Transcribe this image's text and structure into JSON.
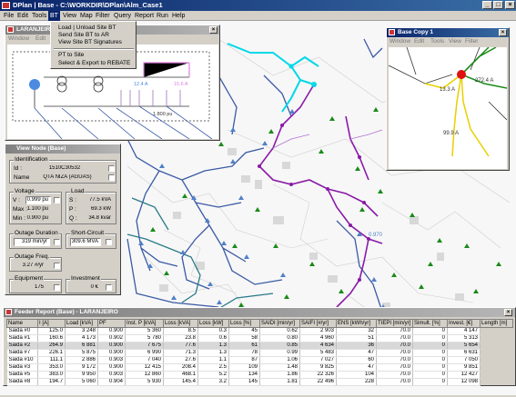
{
  "app": {
    "title": "DPlan  |  Base - C:\\WORKDIR\\DPlan\\Alm_Case1",
    "btn_min": "_",
    "btn_max": "□",
    "btn_close": "×"
  },
  "menu": [
    "File",
    "Edit",
    "Tools",
    "BT",
    "View",
    "Map",
    "Filter",
    "Query",
    "Report",
    "Run",
    "Help"
  ],
  "bt_menu": {
    "items": [
      "Load | Unload Site BT",
      "Send Site BT to AR",
      "View Site BT Signatures",
      "PT to Site",
      "Select & Export to REBATE"
    ]
  },
  "schematic": {
    "title": "LARANJEIRO",
    "menu": [
      "Window",
      "Edit"
    ],
    "labels": {
      "a": "12.4 A",
      "b": "15.6 A",
      "c": "1.800 pu"
    }
  },
  "base_copy": {
    "title": "Base Copy 1",
    "menu": [
      "Window",
      "Edit",
      "Tools",
      "View",
      "Filter"
    ],
    "labels": {
      "a": "13.3 A",
      "b": "272.4 A",
      "c": "99.9 A"
    }
  },
  "map_labels": {
    "a": "0.970"
  },
  "view_node": {
    "title": "View Node (Base)",
    "identification": {
      "legend": "Identification",
      "id_label": "Id :",
      "id_value": "1510C30532",
      "name_label": "Name",
      "name_value": "QTA NIZA (AGUAS)"
    },
    "voltage": {
      "legend": "Voltage",
      "v_label": "V :",
      "v_value": "0.999 pu",
      "max_label": "Max :",
      "max_value": "1.100 pu",
      "min_label": "Min :",
      "min_value": "0.900 pu"
    },
    "load": {
      "legend": "Load",
      "s_label": "S :",
      "s_value": "77.5 kVA",
      "p_label": "P :",
      "p_value": "69.3 kW",
      "q_label": "Q :",
      "q_value": "34.8 kvar"
    },
    "outage_duration": {
      "legend": "Outage Duration",
      "value": "319 min/yr"
    },
    "short_circuit": {
      "legend": "Short-Circuit",
      "value": "309.6 MVA"
    },
    "outage_freq": {
      "legend": "Outage Freq.",
      "value": "3.27 #/yr"
    },
    "equipment": {
      "legend": "Equipment",
      "value": "175"
    },
    "investment": {
      "legend": "Investment",
      "value": "0 €"
    }
  },
  "feeder_report": {
    "title": "Feeder Report (Base) - LARANJEIRO",
    "columns": [
      "Name",
      "I [A]",
      "Load [kVA]",
      "PF",
      "Inst. P [kVA]",
      "Loss [kVA]",
      "Loss [kW]",
      "Loss [%]",
      "SAIDI [min/yr]",
      "SAIFI [#/yr]",
      "ENS [kWh/yr]",
      "TIEPI [min/yr]",
      "Simult. [%]",
      "Invest. [€]",
      "Length [m]"
    ],
    "rows": [
      [
        "Saida #0",
        "125.0",
        "3 248",
        "0.900",
        "5 360",
        "8.5",
        "0.3",
        "45",
        "0.62",
        "2 903",
        "32",
        "70.0",
        "0",
        "4 147"
      ],
      [
        "Saida #1",
        "160.6",
        "4 173",
        "0.902",
        "5 780",
        "23.8",
        "0.6",
        "58",
        "0.80",
        "4 960",
        "51",
        "70.0",
        "0",
        "5 313"
      ],
      [
        "Saida #2",
        "264.9",
        "6 881",
        "0.900",
        "7 675",
        "77.6",
        "1.3",
        "61",
        "0.85",
        "4 634",
        "36",
        "70.0",
        "0",
        "5 654"
      ],
      [
        "Saida #7",
        "226.1",
        "5 875",
        "0.900",
        "6 990",
        "71.3",
        "1.3",
        "78",
        "0.99",
        "5 483",
        "47",
        "70.0",
        "0",
        "6 631"
      ],
      [
        "Saida #10",
        "111.1",
        "2 886",
        "0.903",
        "7 040",
        "27.6",
        "1.1",
        "87",
        "1.06",
        "7 027",
        "60",
        "70.0",
        "0",
        "7 050"
      ],
      [
        "Saida #3",
        "353.0",
        "9 172",
        "0.900",
        "12 415",
        "208.4",
        "2.5",
        "109",
        "1.48",
        "9 825",
        "47",
        "70.0",
        "0",
        "9 851"
      ],
      [
        "Saida #5",
        "383.0",
        "9 950",
        "0.903",
        "12 860",
        "468.1",
        "5.2",
        "134",
        "1.86",
        "22 326",
        "104",
        "70.0",
        "0",
        "12 427"
      ],
      [
        "Saida #8",
        "194.7",
        "5 060",
        "0.904",
        "5 930",
        "145.4",
        "3.2",
        "145",
        "1.81",
        "22 496",
        "228",
        "70.0",
        "0",
        "12 098"
      ]
    ],
    "selected_row": 2
  },
  "colors": {
    "feeder_blue": "#3a5aa5",
    "feeder_purple": "#8a1aa8",
    "feeder_cyan": "#00d8e8",
    "feeder_teal": "#2a7a8a",
    "feeder_yellow": "#e8d000",
    "substation_red": "#e01010",
    "node_green": "#1a8a1a",
    "node_blue": "#5080c8"
  }
}
